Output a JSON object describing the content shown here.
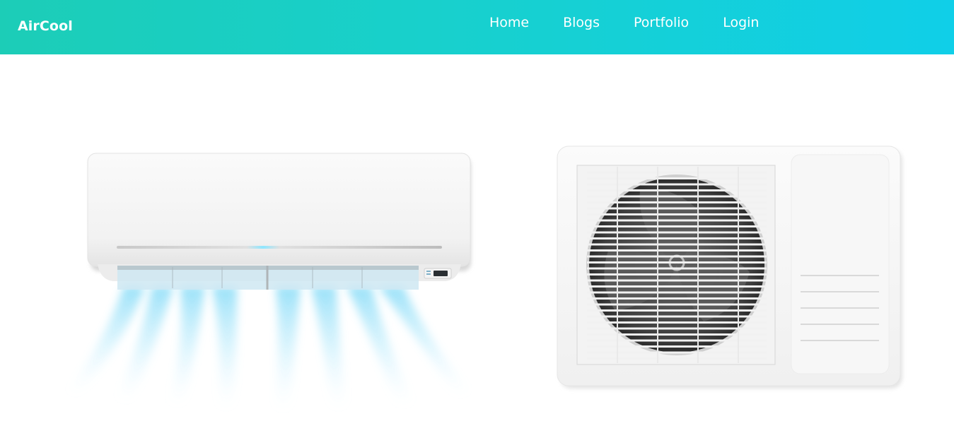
{
  "brand": {
    "name": "AirCool"
  },
  "nav": {
    "items": [
      {
        "label": "Home"
      },
      {
        "label": "Blogs"
      },
      {
        "label": "Portfolio"
      },
      {
        "label": "Login"
      }
    ]
  },
  "colors": {
    "header_gradient_start": "#1ccdb7",
    "header_gradient_end": "#10cfe8",
    "text": "#ffffff",
    "airflow": "#5cd3f5"
  },
  "hero": {
    "illustrations": [
      {
        "icon": "indoor-ac-unit-icon"
      },
      {
        "icon": "outdoor-ac-unit-icon"
      }
    ]
  }
}
